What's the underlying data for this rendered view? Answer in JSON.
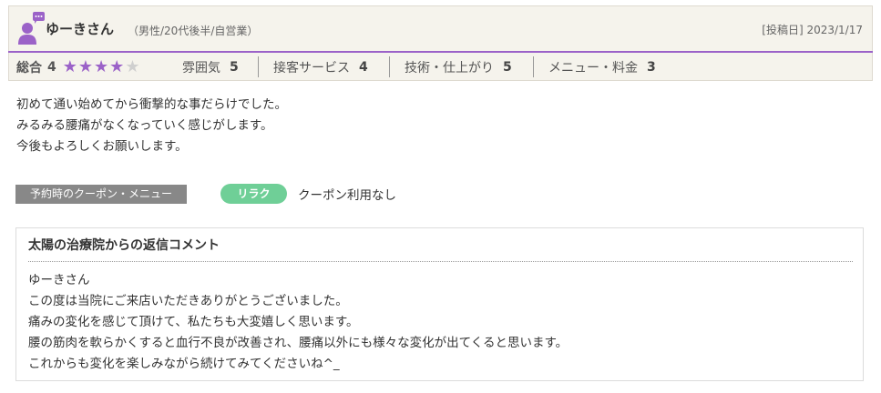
{
  "review": {
    "reviewer_name": "ゆーきさん",
    "reviewer_meta": "（男性/20代後半/自営業）",
    "post_date": "[投稿日] 2023/1/17",
    "ratings": {
      "overall_label": "総合",
      "overall_value": "4",
      "overall_stars": 4,
      "max_stars": 5,
      "items": [
        {
          "label": "雰囲気",
          "value": "5"
        },
        {
          "label": "接客サービス",
          "value": "4"
        },
        {
          "label": "技術・仕上がり",
          "value": "5"
        },
        {
          "label": "メニュー・料金",
          "value": "3"
        }
      ]
    },
    "body_lines": [
      "初めて通い始めてから衝撃的な事だらけでした。",
      "みるみる腰痛がなくなっていく感じがします。",
      "今後もよろしくお願いします。"
    ],
    "coupon": {
      "label": "予約時のクーポン・メニュー",
      "badge": "リラク",
      "value": "クーポン利用なし"
    }
  },
  "reply": {
    "title": "太陽の治療院からの返信コメント",
    "lines": [
      "ゆーきさん",
      "この度は当院にご来店いただきありがとうございました。",
      "痛みの変化を感じて頂けて、私たちも大変嬉しく思います。",
      "腰の筋肉を軟らかくすると血行不良が改善され、腰痛以外にも様々な変化が出てくると思います。",
      "これからも変化を楽しみながら続けてみてくださいね^_"
    ]
  },
  "colors": {
    "accent_purple": "#9b62c8",
    "badge_green": "#6fcf97",
    "header_bg": "#f5f3ec"
  },
  "icons": {
    "avatar": "user-chat-icon",
    "star": "star-icon"
  }
}
